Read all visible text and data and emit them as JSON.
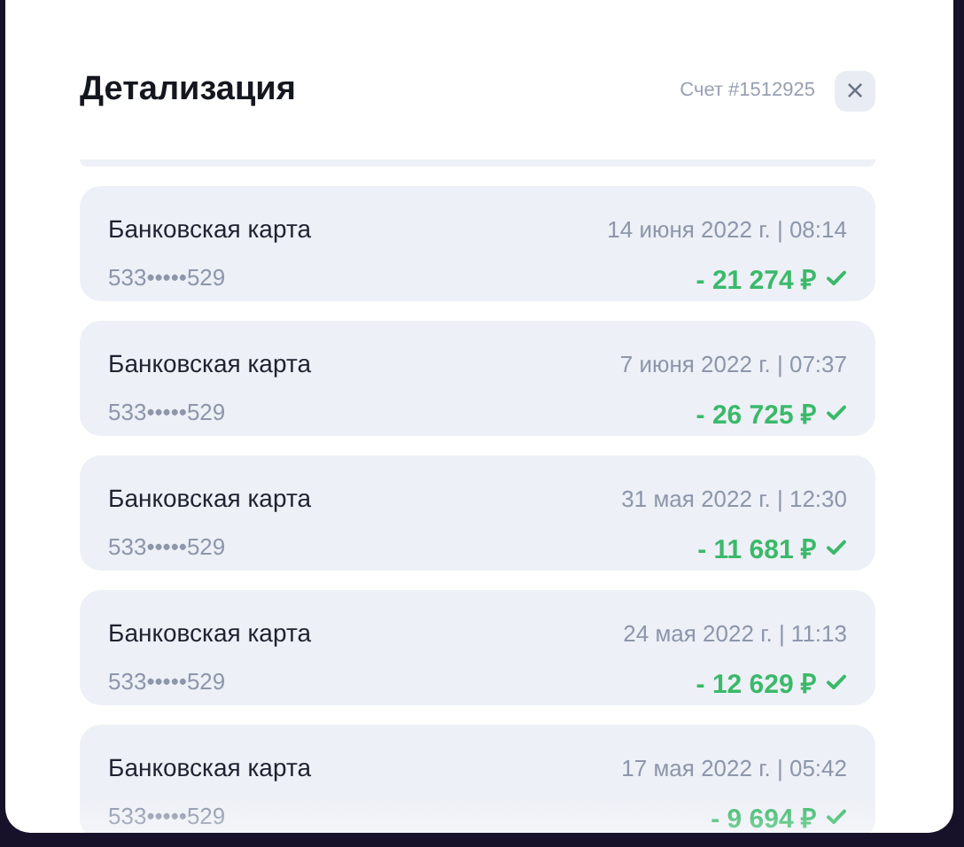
{
  "dialog": {
    "title": "Детализация",
    "account": "Счет #1512925",
    "close": "×"
  },
  "transactions": [
    {
      "method": "Банковская карта",
      "card": "533•••••529",
      "date": "14 июня 2022 г. | 08:14",
      "amount": "- 21 274 ₽"
    },
    {
      "method": "Банковская карта",
      "card": "533•••••529",
      "date": "7 июня 2022 г. | 07:37",
      "amount": "- 26 725 ₽"
    },
    {
      "method": "Банковская карта",
      "card": "533•••••529",
      "date": "31 мая 2022 г. | 12:30",
      "amount": "- 11 681 ₽"
    },
    {
      "method": "Банковская карта",
      "card": "533•••••529",
      "date": "24 мая 2022 г. | 11:13",
      "amount": "- 12 629 ₽"
    },
    {
      "method": "Банковская карта",
      "card": "533•••••529",
      "date": "17 мая 2022 г. | 05:42",
      "amount": "- 9 694 ₽"
    }
  ]
}
